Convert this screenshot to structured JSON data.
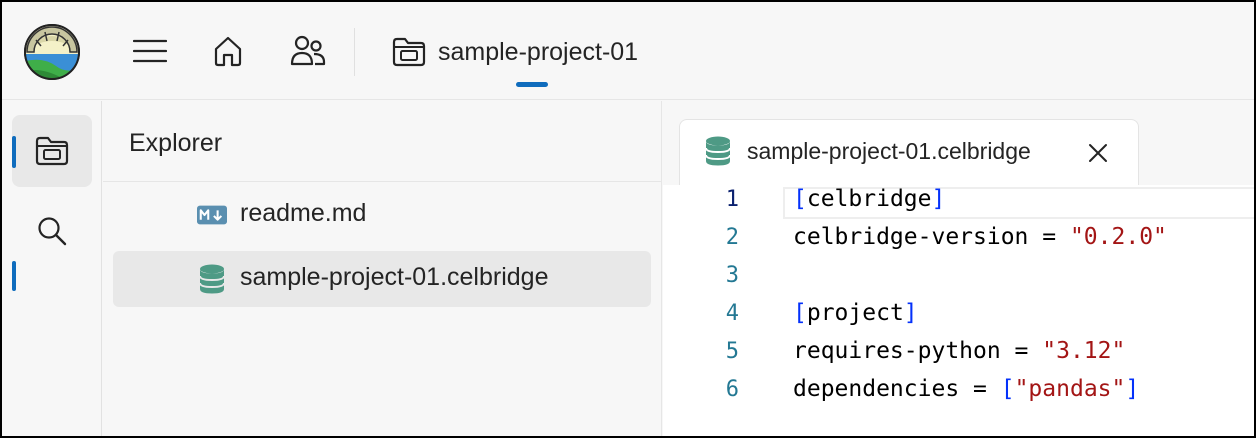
{
  "topbar": {
    "logo_icon": "app-logo-bridge",
    "menu_icon": "hamburger-menu-icon",
    "home_icon": "home-icon",
    "people_icon": "people-icon",
    "project_icon": "folder-icon",
    "project_name": "sample-project-01",
    "accent_color": "#0f6cbd"
  },
  "rail": {
    "items": [
      {
        "icon": "folder-icon",
        "active": true
      },
      {
        "icon": "search-icon",
        "active": false
      }
    ]
  },
  "explorer": {
    "title": "Explorer",
    "files": [
      {
        "name": "readme.md",
        "icon": "markdown-icon",
        "selected": false
      },
      {
        "name": "sample-project-01.celbridge",
        "icon": "database-icon",
        "selected": true
      }
    ]
  },
  "editor": {
    "tab": {
      "label": "sample-project-01.celbridge",
      "icon": "database-icon",
      "close_icon": "close-icon"
    },
    "active_line": 1,
    "lines": [
      {
        "number": "1",
        "text": "[celbridge]"
      },
      {
        "number": "2",
        "text": "celbridge-version = \"0.2.0\""
      },
      {
        "number": "3",
        "text": ""
      },
      {
        "number": "4",
        "text": "[project]"
      },
      {
        "number": "5",
        "text": "requires-python = \"3.12\""
      },
      {
        "number": "6",
        "text": "dependencies = [\"pandas\"]"
      }
    ],
    "colors": {
      "bracket": "#0431fa",
      "string": "#a31515",
      "line_number": "#237893"
    }
  }
}
